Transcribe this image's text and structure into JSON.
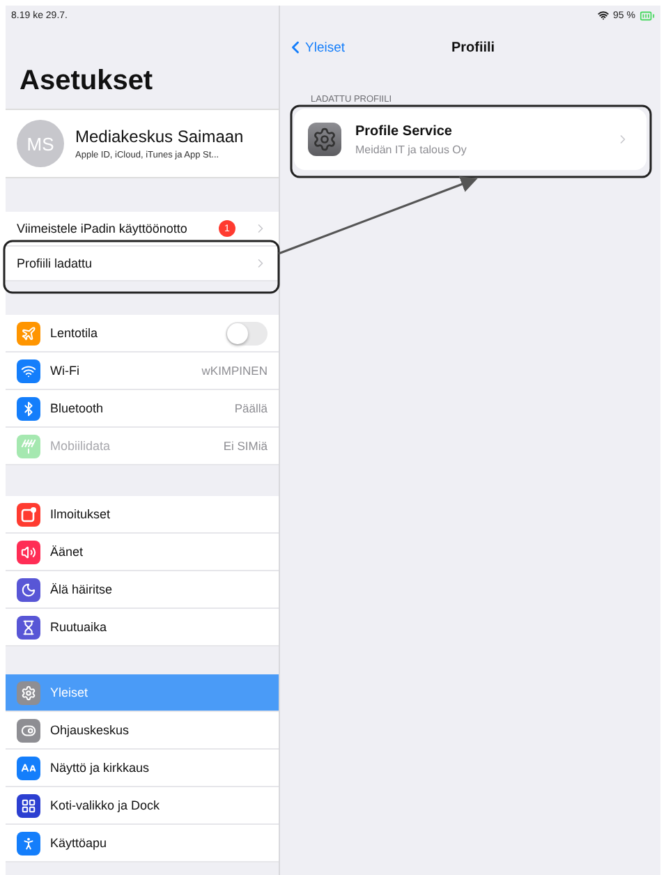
{
  "status_bar": {
    "time": "8.19  ke 29.7.",
    "battery": "95 %"
  },
  "sidebar": {
    "title": "Asetukset",
    "account": {
      "initials": "MS",
      "name": "Mediakeskus Saimaan",
      "subtitle": "Apple ID, iCloud, iTunes ja App St..."
    },
    "groups": [
      [
        {
          "kind": "link",
          "label": "Viimeistele iPadin käyttöönotto",
          "badge": "1",
          "selected": false,
          "disabled": false
        },
        {
          "kind": "link",
          "label": "Profiili ladattu",
          "selected": false,
          "disabled": false
        }
      ],
      [
        {
          "kind": "toggle",
          "label": "Lentotila",
          "color": "#ff9500",
          "on": false,
          "selected": false,
          "disabled": false
        },
        {
          "kind": "value",
          "label": "Wi-Fi",
          "color": "#147efb",
          "value": "wKIMPINEN",
          "selected": false,
          "disabled": false
        },
        {
          "kind": "value",
          "label": "Bluetooth",
          "color": "#147efb",
          "value": "Päällä",
          "selected": false,
          "disabled": false
        },
        {
          "kind": "value",
          "label": "Mobiilidata",
          "color": "#a5e8b0",
          "value": "Ei SIMiä",
          "selected": false,
          "disabled": true
        }
      ],
      [
        {
          "kind": "plain",
          "label": "Ilmoitukset",
          "color": "#ff3b30",
          "selected": false,
          "disabled": false
        },
        {
          "kind": "plain",
          "label": "Äänet",
          "color": "#ff2d55",
          "selected": false,
          "disabled": false
        },
        {
          "kind": "plain",
          "label": "Älä häiritse",
          "color": "#5856d6",
          "selected": false,
          "disabled": false
        },
        {
          "kind": "plain",
          "label": "Ruutuaika",
          "color": "#5856d6",
          "selected": false,
          "disabled": false
        }
      ],
      [
        {
          "kind": "plain",
          "label": "Yleiset",
          "color": "#8e8e93",
          "selected": true,
          "disabled": false
        },
        {
          "kind": "plain",
          "label": "Ohjauskeskus",
          "color": "#8e8e93",
          "selected": false,
          "disabled": false
        },
        {
          "kind": "plain",
          "label": "Näyttö ja kirkkaus",
          "color": "#147efb",
          "selected": false,
          "disabled": false
        },
        {
          "kind": "plain",
          "label": "Koti-valikko ja Dock",
          "color": "#2c3fd1",
          "selected": false,
          "disabled": false
        },
        {
          "kind": "plain",
          "label": "Käyttöapu",
          "color": "#147efb",
          "selected": false,
          "disabled": false
        }
      ]
    ]
  },
  "detail": {
    "back": "Yleiset",
    "title": "Profiili",
    "section_header": "LADATTU PROFIILI",
    "profile": {
      "name": "Profile Service",
      "organization": "Meidän IT ja talous Oy"
    }
  }
}
